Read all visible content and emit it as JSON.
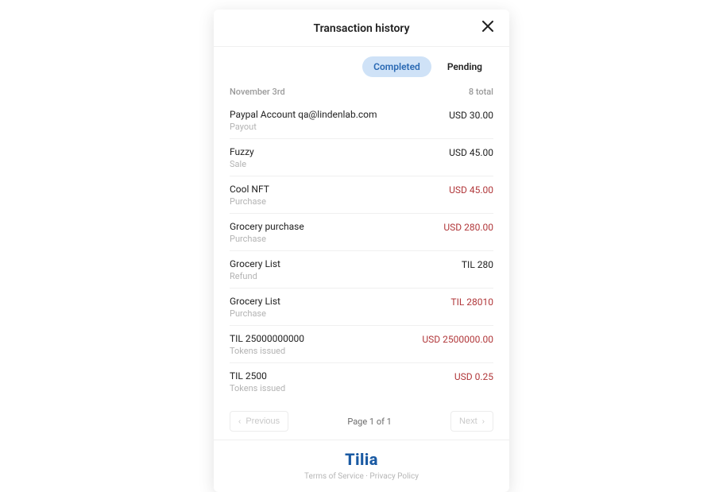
{
  "header": {
    "title": "Transaction history",
    "close_aria": "Close"
  },
  "tabs": {
    "completed": "Completed",
    "pending": "Pending",
    "active": "completed"
  },
  "section": {
    "date": "November 3rd",
    "total": "8 total"
  },
  "transactions": [
    {
      "title": "Paypal Account qa@lindenlab.com",
      "subtitle": "Payout",
      "amount": "USD 30.00",
      "neg": false
    },
    {
      "title": "Fuzzy",
      "subtitle": "Sale",
      "amount": "USD 45.00",
      "neg": false
    },
    {
      "title": "Cool NFT",
      "subtitle": "Purchase",
      "amount": "USD 45.00",
      "neg": true
    },
    {
      "title": "Grocery purchase",
      "subtitle": "Purchase",
      "amount": "USD 280.00",
      "neg": true
    },
    {
      "title": "Grocery List",
      "subtitle": "Refund",
      "amount": "TIL 280",
      "neg": false
    },
    {
      "title": "Grocery List",
      "subtitle": "Purchase",
      "amount": "TIL 28010",
      "neg": true
    },
    {
      "title": "TIL 25000000000",
      "subtitle": "Tokens issued",
      "amount": "USD 2500000.00",
      "neg": true
    },
    {
      "title": "TIL 2500",
      "subtitle": "Tokens issued",
      "amount": "USD 0.25",
      "neg": true
    }
  ],
  "pager": {
    "previous": "Previous",
    "next": "Next",
    "status": "Page 1 of 1"
  },
  "footer": {
    "logo": "Tilia",
    "terms": "Terms of Service",
    "sep": " · ",
    "privacy": "Privacy Policy"
  }
}
